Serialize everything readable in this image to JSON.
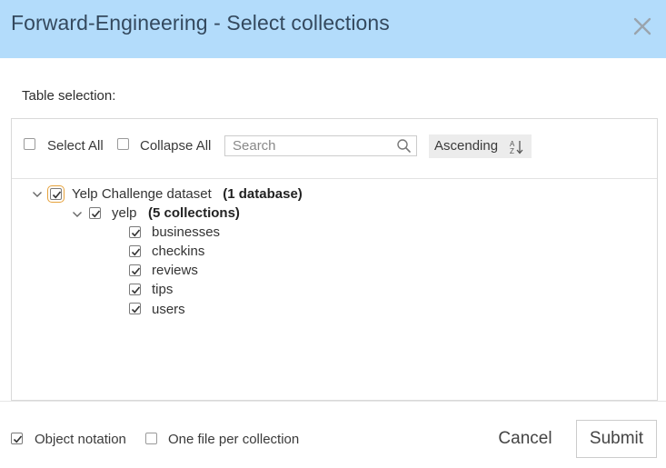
{
  "dialog": {
    "title": "Forward-Engineering - Select collections",
    "close_icon": "close-icon"
  },
  "selection": {
    "label": "Table selection:",
    "select_all_label": "Select All",
    "select_all_checked": false,
    "collapse_all_label": "Collapse All",
    "collapse_all_checked": false,
    "search_placeholder": "Search",
    "search_value": "",
    "sort_label": "Ascending",
    "sort_icon": "sort-alpha-icon"
  },
  "tree": {
    "root": {
      "name": "Yelp Challenge dataset",
      "count_label": "(1 database)",
      "checked": true,
      "expanded": true
    },
    "database": {
      "name": "yelp",
      "count_label": "(5 collections)",
      "checked": true,
      "expanded": true
    },
    "collections": [
      {
        "name": "businesses",
        "checked": true
      },
      {
        "name": "checkins",
        "checked": true
      },
      {
        "name": "reviews",
        "checked": true
      },
      {
        "name": "tips",
        "checked": true
      },
      {
        "name": "users",
        "checked": true
      }
    ]
  },
  "footer": {
    "object_notation_label": "Object notation",
    "object_notation_checked": true,
    "one_file_label": "One file per collection",
    "one_file_checked": false,
    "cancel_label": "Cancel",
    "submit_label": "Submit"
  },
  "colors": {
    "header_bg": "#b3dcfb",
    "title_text": "#34495e",
    "focus_outline": "#e6a23c"
  }
}
